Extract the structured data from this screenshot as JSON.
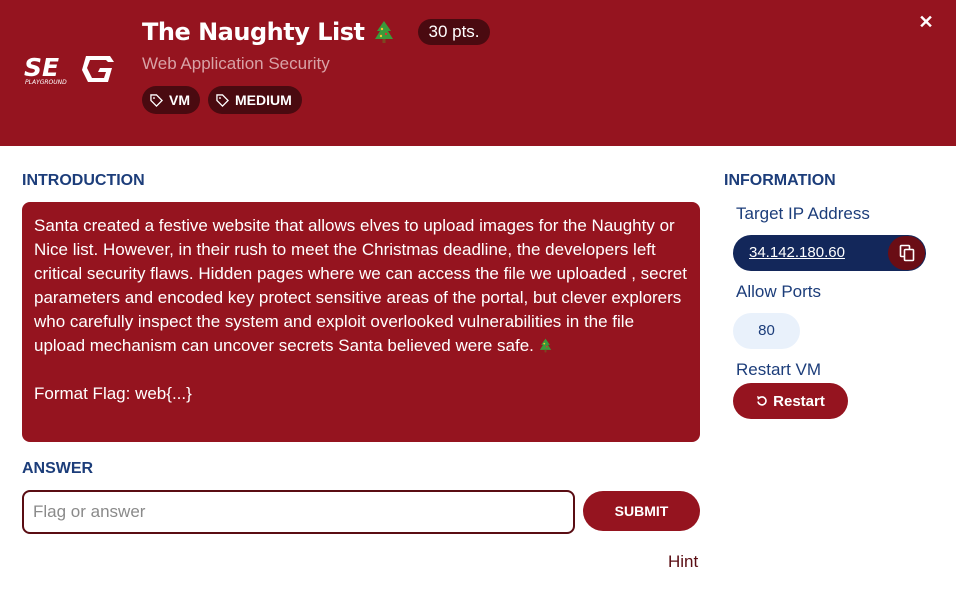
{
  "header": {
    "logo_text": "SEG",
    "logo_sub": "PLAYGROUND",
    "title": "The Naughty List",
    "points": "30 pts.",
    "subtitle": "Web Application Security",
    "tags": [
      {
        "label": "VM",
        "icon": "tag-icon"
      },
      {
        "label": "MEDIUM",
        "icon": "tag-icon"
      }
    ],
    "close_icon": "close-icon"
  },
  "intro": {
    "heading": "INTRODUCTION",
    "paragraph": "Santa created a festive website that allows elves to upload images for the Naughty or Nice list. However, in their rush to meet the Christmas deadline, the developers left critical security flaws. Hidden pages where we can access the file we uploaded , secret parameters and encoded key protect sensitive areas of the portal, but clever explorers who carefully inspect the system and exploit overlooked vulnerabilities in the file upload mechanism can uncover secrets Santa believed were safe.",
    "flag_format": "Format Flag: web{...}"
  },
  "answer": {
    "heading": "ANSWER",
    "placeholder": "Flag or answer",
    "value": "",
    "submit_label": "SUBMIT",
    "hint_label": "Hint"
  },
  "info": {
    "heading": "INFORMATION",
    "target_ip_label": "Target IP Address",
    "target_ip": "34.142.180.60",
    "allow_ports_label": "Allow Ports",
    "port": "80",
    "restart_label": "Restart VM",
    "restart_button": "Restart"
  },
  "colors": {
    "brand_red": "#95141f",
    "dark_red": "#4a0a10",
    "navy": "#13275a",
    "heading_blue": "#1c3d7a"
  }
}
